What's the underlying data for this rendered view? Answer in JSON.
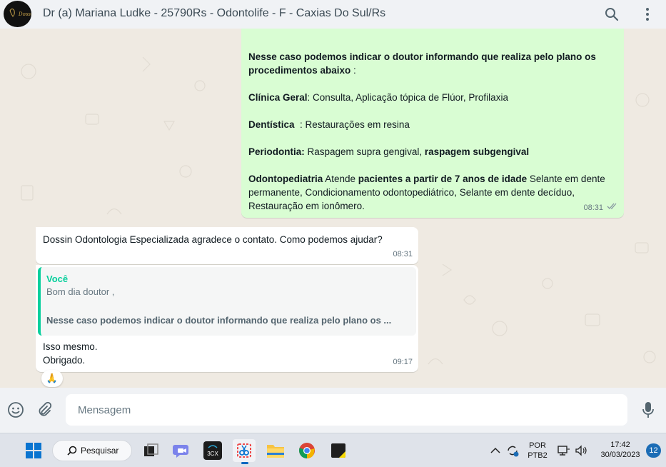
{
  "header": {
    "title": "Dr (a) Mariana Ludke - 25790Rs - Odontolife - F - Caxias Do Sul/Rs",
    "avatar_text": "Dossin"
  },
  "messages": {
    "m1": {
      "intro_bold": "Nesse caso podemos indicar o doutor informando que realiza pelo plano os procedimentos abaixo",
      "intro_rest": " :",
      "clinica_label": "Clínica Geral",
      "clinica_text": ": Consulta, Aplicação tópica de Flúor, Profilaxia",
      "dentistica_label": "Dentística",
      "dentistica_text": "  : Restaurações em resina",
      "perio_label": "Periodontia:",
      "perio_text": " Raspagem supra gengival, ",
      "perio_bold2": "raspagem subgengival",
      "odonto_label": "Odontopediatria",
      "odonto_text1": " Atende ",
      "odonto_bold2": "pacientes a partir de 7 anos de idade",
      "odonto_text2": " Selante em dente permanente, Condicionamento odontopediátrico, Selante em dente decíduo, Restauração em ionômero.",
      "time": "08:31"
    },
    "m2": {
      "text": "Dossin Odontologia Especializada agradece o contato. Como podemos ajudar?",
      "time": "08:31"
    },
    "m3": {
      "quote_author": "Você",
      "quote_line1": "Bom dia doutor ,",
      "quote_line2": "Nesse caso podemos indicar o doutor informando que realiza pelo plano os ...",
      "reply_line1": "Isso mesmo.",
      "reply_line2": "Obrigado.",
      "time": "09:17",
      "reaction": "🙏"
    }
  },
  "composer": {
    "placeholder": "Mensagem"
  },
  "taskbar": {
    "search_label": "Pesquisar",
    "lang_line1": "POR",
    "lang_line2": "PTB2",
    "clock_time": "17:42",
    "clock_date": "30/03/2023",
    "notification_count": "12",
    "app_3cx": "3CX"
  },
  "colors": {
    "outgoing_bubble": "#d9fdd3",
    "incoming_bubble": "#ffffff",
    "accent": "#06cf9c",
    "chat_bg": "#efeae2"
  }
}
